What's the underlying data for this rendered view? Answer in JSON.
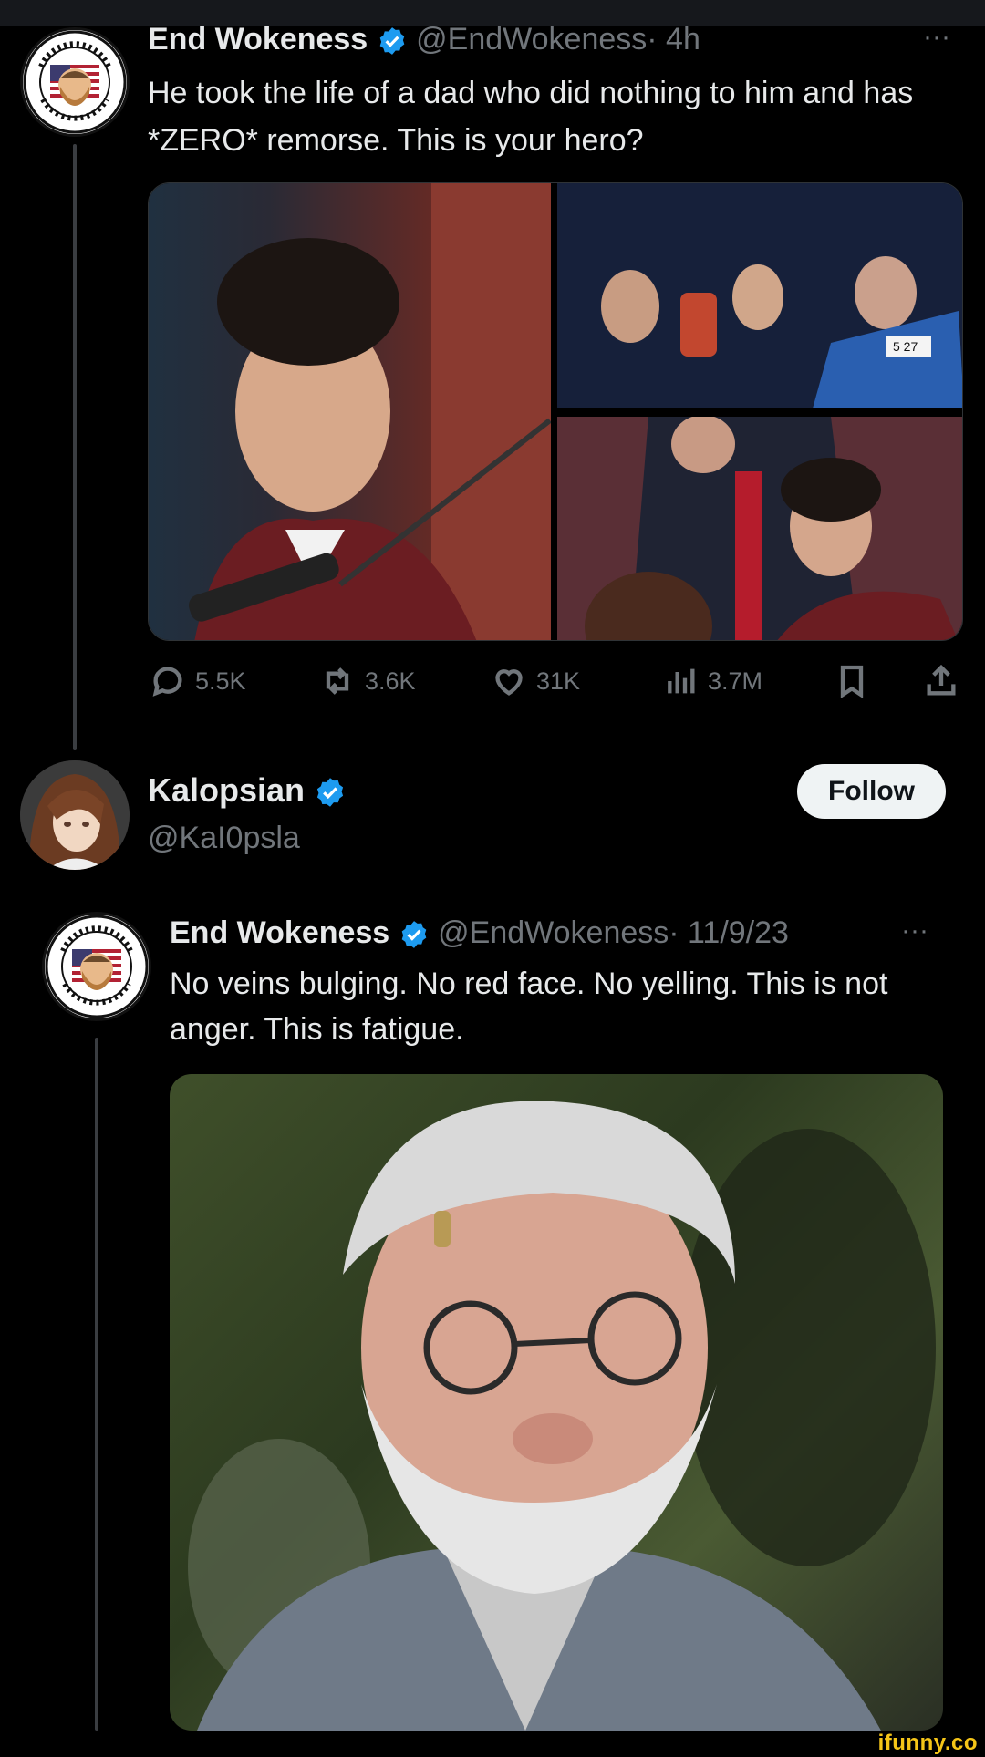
{
  "tweet": {
    "author_name": "End Wokeness",
    "author_handle": "@EndWokeness",
    "time": "· 4h",
    "more": "···",
    "text": "He took the life of a dad who did nothing to him and has *ZERO* remorse. This is your hero?",
    "avatar_badge_text": "I SUPPORT THE FORMER THING",
    "photo_caption_plate": "5 27",
    "stats": {
      "replies": "5.5K",
      "reposts": "3.6K",
      "likes": "31K",
      "views": "3.7M"
    }
  },
  "reply": {
    "author_name": "Kalopsian",
    "author_handle": "@KaI0psla",
    "follow_label": "Follow"
  },
  "quoted": {
    "author_name": "End Wokeness",
    "author_handle": "@EndWokeness",
    "time": "· 11/9/23",
    "more": "···",
    "text": "No veins bulging. No red face. No yelling. This is not anger. This is fatigue."
  },
  "watermark": "ifunny.co",
  "colors": {
    "background": "#000000",
    "text": "#e7e9ea",
    "muted": "#71767b",
    "verified": "#1d9bf0",
    "follow_bg": "#eff3f4",
    "watermark": "#f5c518"
  }
}
